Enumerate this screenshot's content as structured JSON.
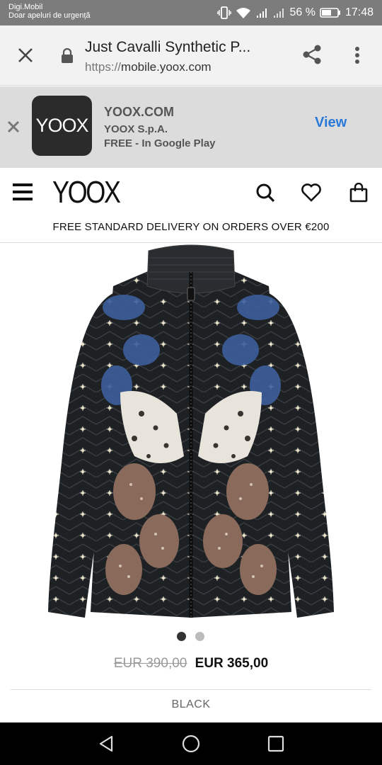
{
  "status_bar": {
    "carrier": "Digi.Mobil",
    "emergency": "Doar apeluri de urgență",
    "battery": "56 %",
    "time": "17:48"
  },
  "browser": {
    "page_title": "Just Cavalli Synthetic P...",
    "url_scheme": "https://",
    "url_host": "mobile.yoox.com"
  },
  "app_banner": {
    "icon_text": "YOOX",
    "name": "YOOX.COM",
    "company": "YOOX S.p.A.",
    "price": "FREE - In Google Play",
    "view_label": "View"
  },
  "site": {
    "logo": "YOOX",
    "delivery_notice": "FREE STANDARD DELIVERY ON ORDERS OVER €200"
  },
  "product": {
    "image_alt": "Just Cavalli Synthetic Padding jacket",
    "image_count": 2,
    "active_image": 1,
    "old_price": "EUR 390,00",
    "new_price": "EUR 365,00",
    "color": "BLACK"
  },
  "colors": {
    "status_bar": "#7c7c7c",
    "link_blue": "#2979d8",
    "jacket_black": "#1e2124",
    "print_blue": "#3d5f9c",
    "print_brown": "#8a6a5a"
  }
}
